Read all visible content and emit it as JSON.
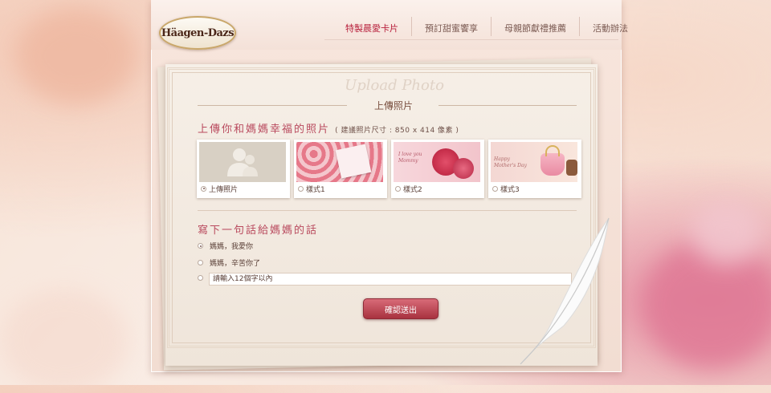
{
  "brand": {
    "logo_text": "Häagen-Dazs"
  },
  "nav": {
    "items": [
      {
        "label": "特製晨愛卡片",
        "active": true
      },
      {
        "label": "預訂甜蜜饗享",
        "active": false
      },
      {
        "label": "母親節獻禮推薦",
        "active": false
      },
      {
        "label": "活動辦法",
        "active": false
      }
    ]
  },
  "card": {
    "script_title": "Upload Photo",
    "title": "上傳照片",
    "upload_heading": "上傳你和媽媽幸福的照片",
    "upload_hint": "( 建議照片尺寸 : 850 x 414 像素 )",
    "thumbnails": [
      {
        "label": "上傳照片",
        "selected": true,
        "icon": "users-icon"
      },
      {
        "label": "樣式1",
        "selected": false
      },
      {
        "label": "樣式2",
        "selected": false,
        "image_text": "I love you Mommy"
      },
      {
        "label": "樣式3",
        "selected": false,
        "image_text": "Happy Mother's Day"
      }
    ],
    "message_heading": "寫下一句話給媽媽的話",
    "messages": [
      {
        "label": "媽媽，我愛你",
        "selected": true
      },
      {
        "label": "媽媽，辛苦你了",
        "selected": false
      }
    ],
    "custom_message_placeholder": "請輸入12個字以內",
    "submit_label": "確認送出"
  },
  "colors": {
    "accent": "#b8203c",
    "heading": "#b94a5e",
    "button": "#a8323f"
  }
}
